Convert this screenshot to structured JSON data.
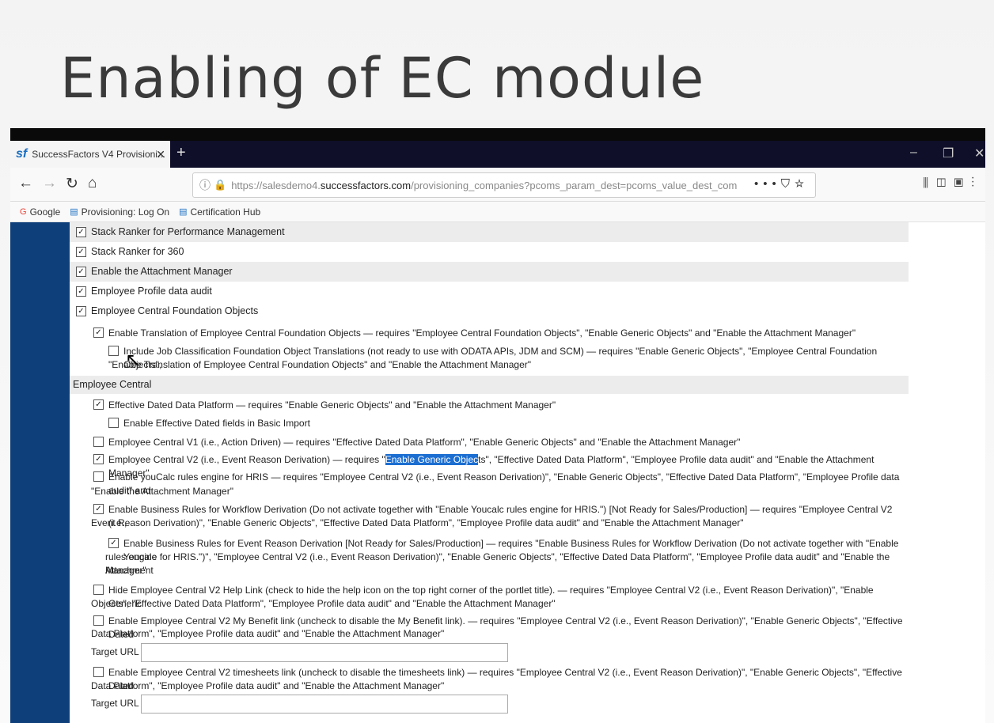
{
  "slide": {
    "title": "Enabling of EC module"
  },
  "browser": {
    "tab_title": "SuccessFactors V4 Provisioni...",
    "tab_logo": "sf",
    "url_domain_prefix": "https://salesdemo4.",
    "url_domain": "successfactors.com",
    "url_path": "/provisioning_companies?pcoms_param_dest=pcoms_value_dest_comdn",
    "bookmarks": [
      "Google",
      "Provisioning: Log On",
      "Certification Hub"
    ],
    "icons": [
      "back-icon",
      "forward-icon",
      "reload-icon",
      "home-icon",
      "info-icon",
      "lock-icon",
      "more-icon",
      "pocket-icon",
      "star-icon",
      "library-icon",
      "sidebar-icon",
      "extension-icon",
      "menu-icon"
    ]
  },
  "settings": [
    {
      "label": "Stack Ranker for Performance Management",
      "checked": true
    },
    {
      "label": "Stack Ranker for 360",
      "checked": true
    },
    {
      "label": "Enable the Attachment Manager",
      "checked": true
    },
    {
      "label": "Employee Profile data audit",
      "checked": true
    },
    {
      "label": "Employee Central Foundation Objects",
      "checked": true
    },
    {
      "label": "Enable Translation of Employee Central Foundation Objects — requires \"Employee Central Foundation Objects\", \"Enable Generic Objects\" and \"Enable the Attachment Manager\"",
      "checked": true
    },
    {
      "label": "Include Job Classification Foundation Object Translations (not ready to use with ODATA APIs, JDM and SCM) — requires \"Enable Generic Objects\", \"Employee Central Foundation Objects\",",
      "label2": "\"Enable Translation of Employee Central Foundation Objects\" and \"Enable the Attachment Manager\"",
      "checked": false
    },
    {
      "label": "Employee Central",
      "section": true
    },
    {
      "label": "Effective Dated Data Platform — requires \"Enable Generic Objects\" and \"Enable the Attachment Manager\"",
      "checked": true
    },
    {
      "label": "Enable Effective Dated fields in Basic Import",
      "checked": false
    },
    {
      "label": "Employee Central V1 (i.e., Action Driven) — requires \"Effective Dated Data Platform\", \"Enable Generic Objects\" and \"Enable the Attachment Manager\"",
      "checked": false
    },
    {
      "label_pre": "Employee Central V2 (i.e., Event Reason Derivation) — requires \"",
      "label_hl": "Enable Generic Objec",
      "label_post": "ts\", \"Effective Dated Data Platform\", \"Employee Profile data audit\" and \"Enable the Attachment Manager\"",
      "checked": true
    },
    {
      "label": "Enable youCalc rules engine for HRIS — requires \"Employee Central V2 (i.e., Event Reason Derivation)\", \"Enable Generic Objects\", \"Effective Dated Data Platform\", \"Employee Profile data audit\" and",
      "label2": "\"Enable the Attachment Manager\"",
      "checked": false
    },
    {
      "label": "Enable Business Rules for Workflow Derivation (Do not activate together with \"Enable Youcalc rules engine for HRIS.\") [Not Ready for Sales/Production] — requires \"Employee Central V2 (i.e.,",
      "label2": "Event Reason Derivation)\", \"Enable Generic Objects\", \"Effective Dated Data Platform\", \"Employee Profile data audit\" and \"Enable the Attachment Manager\"",
      "checked": true
    },
    {
      "label": "Enable Business Rules for Event Reason Derivation [Not Ready for Sales/Production] — requires \"Enable Business Rules for Workflow Derivation (Do not activate together with \"Enable Youcalc",
      "label2": "rules engine for HRIS.\")\", \"Employee Central V2 (i.e., Event Reason Derivation)\", \"Enable Generic Objects\", \"Effective Dated Data Platform\", \"Employee Profile data audit\" and \"Enable the Attachment",
      "label3": "Manager\"",
      "checked": true
    },
    {
      "label": "Hide Employee Central V2 Help Link (check to hide the help icon on the top right corner of the portlet title). — requires \"Employee Central V2 (i.e., Event Reason Derivation)\", \"Enable Generic",
      "label2": "Objects\", \"Effective Dated Data Platform\", \"Employee Profile data audit\" and \"Enable the Attachment Manager\"",
      "checked": false
    },
    {
      "label": "Enable Employee Central V2 My Benefit link (uncheck to disable the My Benefit link). — requires \"Employee Central V2 (i.e., Event Reason Derivation)\", \"Enable Generic Objects\", \"Effective Dated",
      "label2": "Data Platform\", \"Employee Profile data audit\" and \"Enable the Attachment Manager\"",
      "checked": false
    },
    {
      "label": "Target URL",
      "input": true,
      "value": ""
    },
    {
      "label": "Enable Employee Central V2 timesheets link (uncheck to disable the timesheets link) — requires \"Employee Central V2 (i.e., Event Reason Derivation)\", \"Enable Generic Objects\", \"Effective Dated",
      "label2": "Data Platform\", \"Employee Profile data audit\" and \"Enable the Attachment Manager\"",
      "checked": false
    },
    {
      "label": "Target URL",
      "input": true,
      "value": ""
    }
  ]
}
